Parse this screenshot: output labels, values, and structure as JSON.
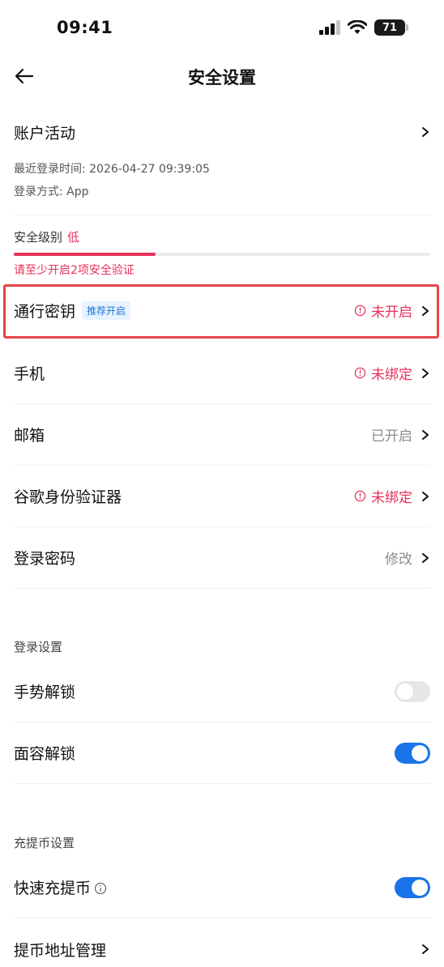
{
  "status_bar": {
    "time": "09:41",
    "battery": "71"
  },
  "nav": {
    "title": "安全设置"
  },
  "account": {
    "title": "账户活动",
    "last_login": "最近登录时间: 2026-04-27 09:39:05",
    "login_method": "登录方式: App"
  },
  "security_level": {
    "label": "安全级别",
    "value": "低",
    "progress": 0.34,
    "hint": "请至少开启2项安全验证"
  },
  "items": [
    {
      "label": "通行密钥",
      "tag": "推荐开启",
      "status": "未开启",
      "warning": true
    },
    {
      "label": "手机",
      "status": "未绑定",
      "warning": true
    },
    {
      "label": "邮箱",
      "status": "已开启",
      "warning": false
    },
    {
      "label": "谷歌身份验证器",
      "status": "未绑定",
      "warning": true
    },
    {
      "label": "登录密码",
      "status": "修改",
      "warning": false
    }
  ],
  "login_settings": {
    "title": "登录设置",
    "items": [
      {
        "label": "手势解锁",
        "enabled": false
      },
      {
        "label": "面容解锁",
        "enabled": true
      }
    ]
  },
  "deposit_settings": {
    "title": "充提币设置",
    "items": [
      {
        "label": "快速充提币",
        "enabled": true
      },
      {
        "label": "提币地址管理"
      }
    ]
  },
  "colors": {
    "warning": "#e8315a",
    "accent": "#1a73e8",
    "highlight": "#e8454a"
  }
}
